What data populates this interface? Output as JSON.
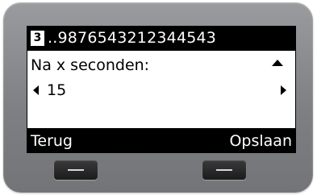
{
  "header": {
    "line_number": "3",
    "phone_number": "..9876543212344543"
  },
  "menu": {
    "label": "Na x seconden:",
    "value": "15"
  },
  "softkeys": {
    "left": "Terug",
    "right": "Opslaan"
  },
  "icons": {
    "scroll_up": "triangle-up-icon",
    "left": "triangle-left-icon",
    "right": "triangle-right-icon"
  },
  "colors": {
    "screen_background": "#000000",
    "content_background": "#ffffff",
    "bezel": "#858689"
  }
}
